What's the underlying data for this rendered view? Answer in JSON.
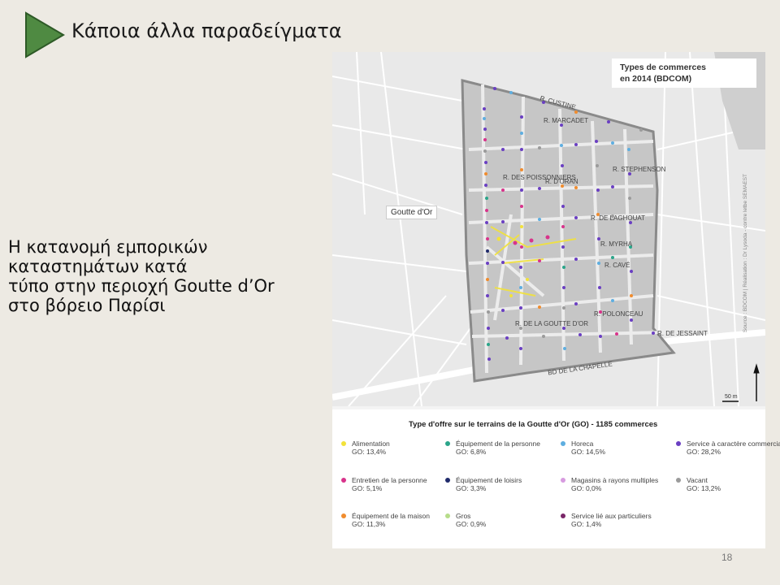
{
  "slide": {
    "title": "Κάποια άλλα παραδείγματα",
    "body_lines": [
      "Η κατανομή εμπορικών",
      "καταστημάτων κατά",
      "τύπο στην περιοχή Goutte d’Or",
      "στο βόρειο Παρίσι"
    ],
    "page_number": "18"
  },
  "map": {
    "title_line1": "Types de commerces",
    "title_line2": "en 2014 (BDCOM)",
    "goutte_label": "Goutte d'Or",
    "scale": "50 m",
    "source": "Source : BDCOM | Réalisation : Dr Lysoda - contre letbe SEMAEST",
    "street_labels": [
      "R. CUSTINE",
      "R. MARCADET",
      "R. POLONCEAU",
      "R. DE JESSAINT",
      "BD DE LA CHAPELLE",
      "R. DE LA GOUTTE D'OR",
      "R. CAVÉ",
      "R. MYRHA",
      "R. DE LAGHOUAT",
      "R. STEPHENSON",
      "R. DES POISSONNIERS",
      "R. D'ORAN"
    ]
  },
  "legend": {
    "title": "Type d'offre sur le terrains de la Goutte d'Or (GO) - 1185 commerces",
    "items": [
      {
        "label": "Alimentation",
        "value": "GO: 13,4%",
        "color": "#f2e23a"
      },
      {
        "label": "Équipement de la personne",
        "value": "GO: 6,8%",
        "color": "#2aa58a"
      },
      {
        "label": "Horeca",
        "value": "GO: 14,5%",
        "color": "#5eaee0"
      },
      {
        "label": "Service à caractère commercial",
        "value": "GO: 28,2%",
        "color": "#6a3fc2"
      },
      {
        "label": "Entretien de la personne",
        "value": "GO: 5,1%",
        "color": "#d8338b"
      },
      {
        "label": "Équipement de loisirs",
        "value": "GO: 3,3%",
        "color": "#1f2a6b"
      },
      {
        "label": "Magasins à rayons multiples",
        "value": "GO: 0,0%",
        "color": "#d79be0"
      },
      {
        "label": "Vacant",
        "value": "GO: 13,2%",
        "color": "#9b9b9b"
      },
      {
        "label": "Équipement de la maison",
        "value": "GO: 11,3%",
        "color": "#f08c2e"
      },
      {
        "label": "Gros",
        "value": "GO: 0,9%",
        "color": "#b6dd8a"
      },
      {
        "label": "Service lié aux particuliers",
        "value": "GO: 1,4%",
        "color": "#7a2668"
      }
    ]
  }
}
